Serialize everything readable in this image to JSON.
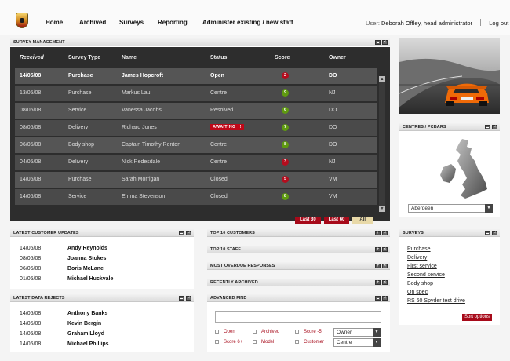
{
  "nav": {
    "items": [
      "Home",
      "Archived",
      "Surveys",
      "Reporting",
      "Administer existing / new staff"
    ]
  },
  "user": {
    "prefix": "User:",
    "name": "Deborah Offley, head administrator",
    "logout": "Log out"
  },
  "survey_management": {
    "title": "SURVEY MANAGEMENT",
    "columns": [
      "Received",
      "Survey Type",
      "Name",
      "Status",
      "Score",
      "Owner"
    ],
    "rows": [
      {
        "received": "14/05/08",
        "type": "Purchase",
        "name": "James Hopcroft",
        "status": "Open",
        "score": "2",
        "score_color": "red",
        "owner": "DO",
        "bold": true
      },
      {
        "received": "13/05/08",
        "type": "Purchase",
        "name": "Markus Lau",
        "status": "Centre",
        "score": "9",
        "score_color": "green",
        "owner": "NJ"
      },
      {
        "received": "08/05/08",
        "type": "Service",
        "name": "Vanessa Jacobs",
        "status": "Resolved",
        "score": "6",
        "score_color": "green",
        "owner": "DO"
      },
      {
        "received": "08/05/08",
        "type": "Delivery",
        "name": "Richard Jones",
        "status": "AWAITING",
        "status_flag": "!",
        "score": "7",
        "score_color": "green",
        "owner": "DO"
      },
      {
        "received": "06/05/08",
        "type": "Body shop",
        "name": "Captain Timothy Renton",
        "status": "Centre",
        "score": "8",
        "score_color": "green",
        "owner": "DO"
      },
      {
        "received": "04/05/08",
        "type": "Delivery",
        "name": "Nick Redesdale",
        "status": "Centre",
        "score": "3",
        "score_color": "red",
        "owner": "NJ"
      },
      {
        "received": "14/05/08",
        "type": "Purchase",
        "name": "Sarah Morrigan",
        "status": "Closed",
        "score": "5",
        "score_color": "red",
        "owner": "VM"
      },
      {
        "received": "14/05/08",
        "type": "Service",
        "name": "Emma Stevenson",
        "status": "Closed",
        "score": "8",
        "score_color": "green",
        "owner": "VM"
      }
    ],
    "filters": [
      "Last 30",
      "Last 60",
      "All"
    ]
  },
  "centres": {
    "title": "CENTRES / PCBARS",
    "selected": "Aberdeen"
  },
  "latest_updates": {
    "title": "LATEST CUSTOMER UPDATES",
    "items": [
      {
        "date": "14/05/08",
        "name": "Andy Reynolds"
      },
      {
        "date": "08/05/08",
        "name": "Joanna Stokes"
      },
      {
        "date": "06/05/08",
        "name": "Boris McLane"
      },
      {
        "date": "01/05/08",
        "name": "Michael Huckvale"
      }
    ]
  },
  "latest_rejects": {
    "title": "LATEST DATA REJECTS",
    "items": [
      {
        "date": "14/05/08",
        "name": "Anthony Banks"
      },
      {
        "date": "14/05/08",
        "name": "Kevin Bergin"
      },
      {
        "date": "14/05/08",
        "name": "Graham Lloyd"
      },
      {
        "date": "14/05/08",
        "name": "Michael Phillips"
      }
    ]
  },
  "middle_panels": [
    "TOP 10 CUSTOMERS",
    "TOP 10 STAFF",
    "MOST OVERDUE RESPONSES",
    "RECENTLY ARCHIVED"
  ],
  "advanced_find": {
    "title": "ADVANCED FIND",
    "search_value": "",
    "checkboxes": [
      "Open",
      "Archived",
      "Score -5",
      "Score 6+",
      "Model",
      "Customer"
    ],
    "owner_select": "Owner",
    "centre_select": "Centre"
  },
  "surveys_panel": {
    "title": "SURVEYS",
    "links": [
      "Purchase",
      "Delivery",
      "First service",
      "Second service",
      "Body shop",
      "On spec",
      "RS 60 Spyder test drive"
    ],
    "sort_label": "Sort options"
  },
  "colors": {
    "accent_red": "#a70a1a",
    "score_green": "#5f9a10",
    "grid_dark": "#2d2d2d"
  }
}
